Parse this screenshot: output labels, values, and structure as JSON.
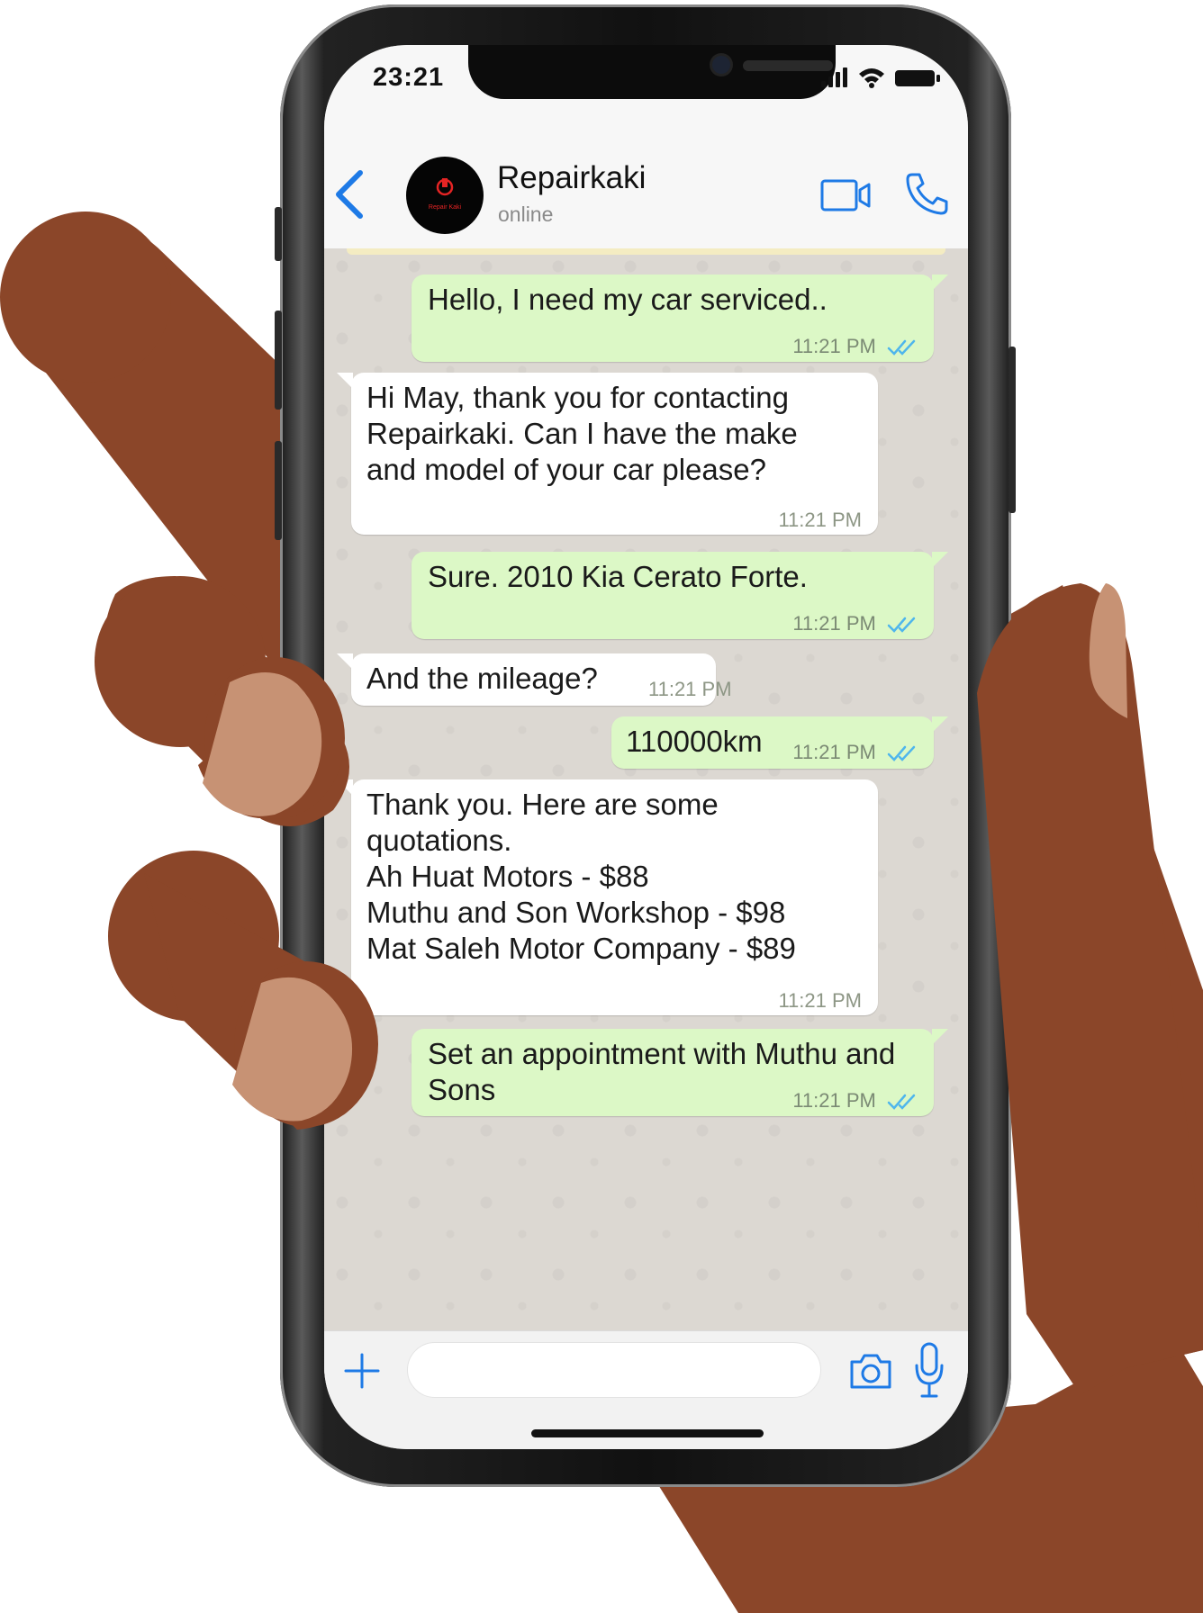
{
  "status_bar": {
    "time": "23:21"
  },
  "header": {
    "contact_name": "Repairkaki",
    "contact_status": "online",
    "avatar_text": "Repair Kaki"
  },
  "messages": [
    {
      "dir": "out",
      "text": "Hello, I need my car serviced..",
      "time": "11:21 PM",
      "read": true
    },
    {
      "dir": "in",
      "text": "Hi May, thank you for contacting\nRepairkaki. Can I have the make\nand model of your car please?",
      "time": "11:21 PM"
    },
    {
      "dir": "out",
      "text": "Sure. 2010 Kia Cerato Forte.",
      "time": "11:21 PM",
      "read": true
    },
    {
      "dir": "in",
      "text": "And the mileage?",
      "time": "11:21 PM"
    },
    {
      "dir": "out",
      "text": "110000km",
      "time": "11:21 PM",
      "read": true
    },
    {
      "dir": "in",
      "text": "Thank you. Here are some\nquotations.\nAh Huat Motors - $88\nMuthu and Son Workshop - $98\nMat Saleh Motor Company - $89",
      "time": "11:21 PM"
    },
    {
      "dir": "out",
      "text": "Set an appointment with Muthu and\nSons",
      "time": "11:21 PM",
      "read": true
    }
  ],
  "input": {
    "value": "",
    "placeholder": ""
  },
  "colors": {
    "accent": "#1e7ae6",
    "outgoing_bubble": "#dcf8c6",
    "incoming_bubble": "#ffffff",
    "chat_background": "#dcd8d2",
    "read_ticks": "#4fb6ec",
    "skin": "#8b4629",
    "nail": "#c79274"
  }
}
